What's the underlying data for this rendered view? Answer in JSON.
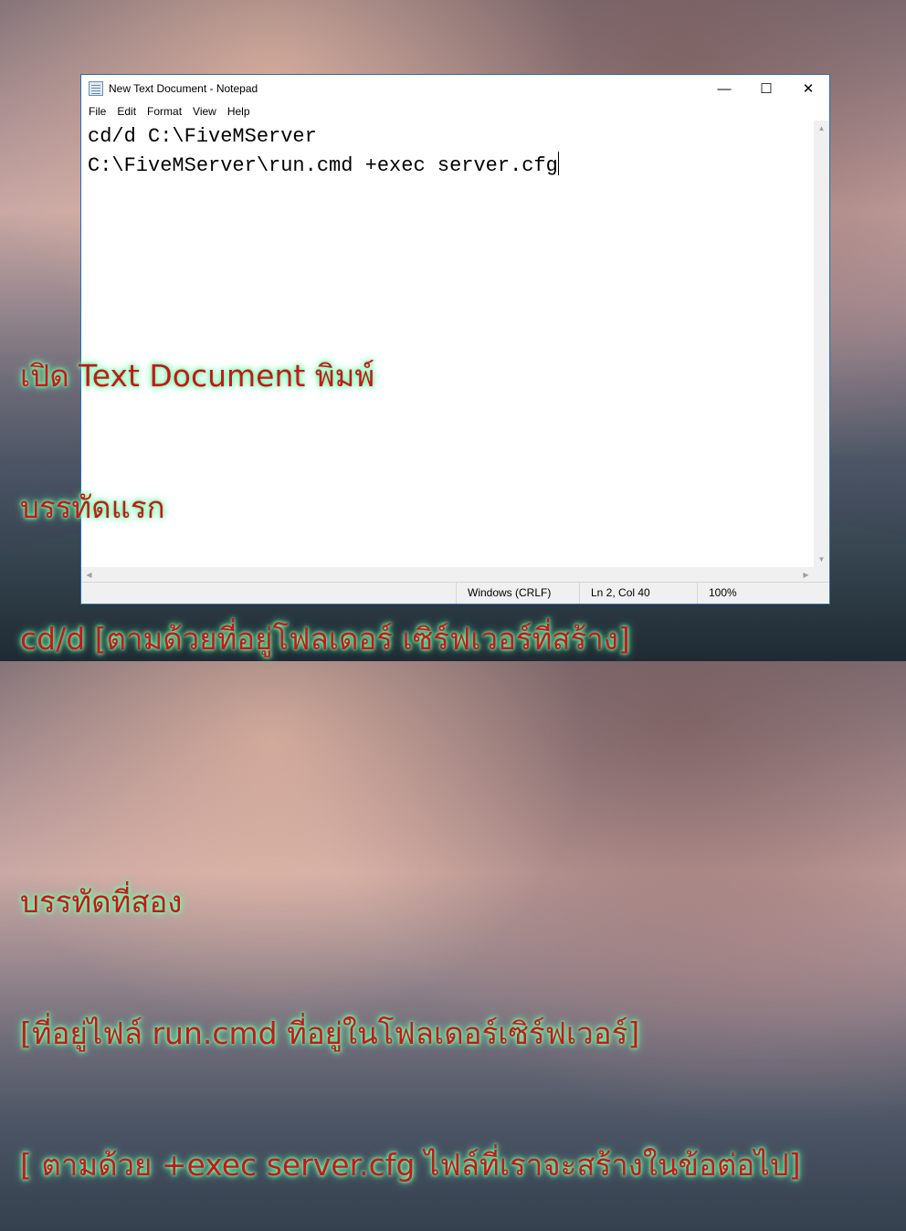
{
  "window": {
    "title": "New Text Document - Notepad",
    "controls": {
      "minimize": "—",
      "maximize": "☐",
      "close": "✕"
    }
  },
  "menu": [
    "File",
    "Edit",
    "Format",
    "View",
    "Help"
  ],
  "editor": {
    "lines": [
      "cd/d C:\\FiveMServer",
      "C:\\FiveMServer\\run.cmd +exec server.cfg"
    ]
  },
  "statusbar": {
    "line_endings": "Windows (CRLF)",
    "position": "Ln 2, Col 40",
    "zoom": "100%"
  },
  "overlay_text": [
    "เปิด Text Document พิมพ์",
    "บรรทัดแรก",
    "cd/d [ตามด้วยที่อยู่โฟลเดอร์ เซิร์ฟเวอร์ที่สร้าง]",
    "",
    "บรรทัดที่สอง",
    "[ที่อยู่ไฟล์ run.cmd ที่อยู่ในโฟลเดอร์เซิร์ฟเวอร์]",
    "[ ตามด้วย +exec server.cfg ไฟล์ที่เราจะสร้างในข้อต่อไป]"
  ],
  "colors": {
    "overlay_text": "#c8161b",
    "overlay_glow": "#7dffb0",
    "window_border": "#2b6cb0"
  }
}
